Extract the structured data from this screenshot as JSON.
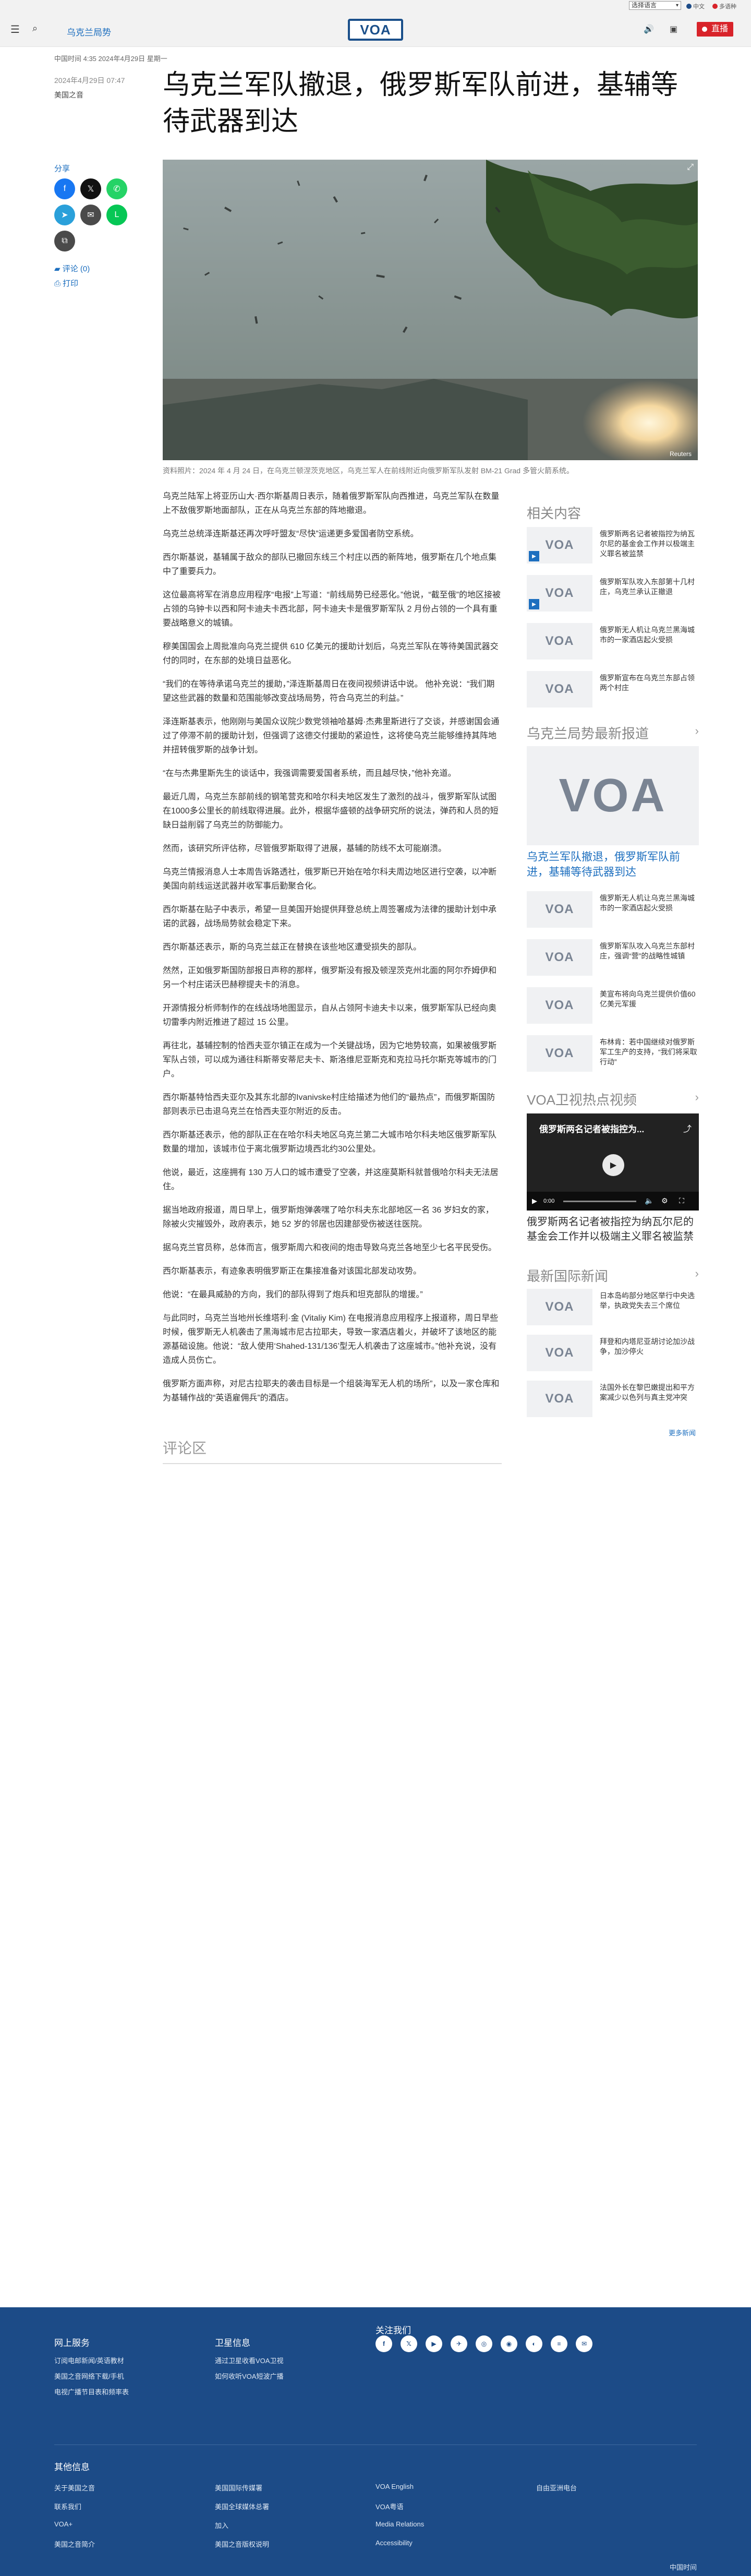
{
  "util": {
    "language": "选择语言",
    "ext1": "中文",
    "ext2": "多语种"
  },
  "header": {
    "section": "乌克兰局势",
    "logo": "VOA",
    "live": "直播"
  },
  "article": {
    "kicker": "中国时间 4:35 2024年4月29日 星期一",
    "date": "2024年4月29日 07:47",
    "source": "美国之音",
    "title": "乌克兰军队撤退，俄罗斯军队前进，基辅等待武器到达",
    "share_label": "分享",
    "comments_link": "评论 (0)",
    "print_link": "打印",
    "image_credit": "Reuters",
    "caption": "资料照片：2024 年 4 月 24 日，在乌克兰顿涅茨克地区，乌克兰军人在前线附近向俄罗斯军队发射 BM-21 Grad 多管火箭系统。",
    "paragraphs": [
      "乌克兰陆军上将亚历山大·西尔斯基周日表示，随着俄罗斯军队向西推进，乌克兰军队在数量上不敌俄罗斯地面部队，正在从乌克兰东部的阵地撤退。",
      "乌克兰总统泽连斯基还再次呼吁盟友“尽快”运递更多爱国者防空系统。",
      "西尔斯基说，基辅属于敌众的部队已撤回东线三个村庄以西的新阵地，俄罗斯在几个地点集中了重要兵力。",
      "这位最高将军在消息应用程序“电报”上写道：“前线局势已经恶化。”他说，“截至俄”的地区接被占领的乌钟卡以西和阿卡迪夫卡西北部，阿卡迪夫卡是俄罗斯军队 2 月份占领的一个具有重要战略意义的城镇。",
      "穆美国国会上周批准向乌克兰提供 610 亿美元的援助计划后，乌克兰军队在等待美国武器交付的同时，在东部的处境日益恶化。",
      "“我们的在等待承诺乌克兰的援助，”泽连斯基周日在夜间视频讲话中说。 他补充说：“我们期望这些武器的数量和范围能够改变战场局势，符合乌克兰的利益。”",
      "泽连斯基表示，他刚刚与美国众议院少数党领袖哈基姆·杰弗里斯进行了交谈，并感谢国会通过了停滞不前的援助计划，但强调了这德交付援助的紧迫性，这将使乌克兰能够维持其阵地并扭转俄罗斯的战争计划。",
      "“在与杰弗里斯先生的谈话中，我强调需要爱国者系统，而且越尽快，”他补充道。",
      "最近几周，乌克兰东部前线的钢笔营克和哈尔科夫地区发生了激烈的战斗，俄罗斯军队试图在1000多公里长的前线取得进展。此外，根据华盛顿的战争研究所的说法，弹药和人员的短缺日益削弱了乌克兰的防御能力。",
      "然而，该研究所评估称，尽管俄罗斯取得了进展，基辅的防线不太可能崩溃。",
      "乌克兰情报消息人士本周告诉路透社，俄罗斯已开始在哈尔科夫周边地区进行空袭，以冲断美国向前线运送武器并收军事后勤聚合化。",
      "西尔斯基在贴子中表示，希望一旦美国开始提供拜登总统上周签署成为法律的援助计划中承诺的武器，战场局势就会稳定下来。",
      "西尔斯基还表示，斯的乌克兰兹正在替换在该些地区遭受损失的部队。",
      "然然，正如俄罗斯国防部报日声称的那样，俄罗斯没有报及顿涅茨克州北面的阿尔乔姆伊和另一个村庄诺沃巴赫穆提夫卡的消息。",
      "开源情报分析师制作的在线战场地图显示，自从占领阿卡迪夫卡以来，俄罗斯军队已经向奥切雷季内附近推进了超过 15 公里。",
      "再往北，基辅控制的恰西夫亚尔镇正在成为一个关键战场，因为它地势较高，如果被俄罗斯军队占领，可以成为通往科斯蒂安蒂尼夫卡、斯洛维尼亚斯克和克拉马托尔斯克等城市的门户。",
      "西尔斯基特恰西夫亚尔及其东北部的Ivanivske村庄给描述为他们的“最热点”，而俄罗斯国防部则表示已击退乌克兰在恰西夫亚尔附近的反击。",
      "西尔斯基还表示，他的部队正在在哈尔科夫地区乌克兰第二大城市哈尔科夫地区俄罗斯军队数量的增加，该城市位于离北俄罗斯边境西北约30公里处。",
      "他说，最近，这座拥有 130 万人口的城市遭受了空袭，并这座莫斯科就普俄哈尔科夫无法居住。",
      "据当地政府报道，周日早上，俄罗斯炮弹袭嘿了哈尔科夫东北部地区一名 36 岁妇女的家，除被火灾摧毁外，政府表示，她 52 岁的邻居也因建部受伤被送往医院。",
      "据乌克兰官员称，总体而言，俄罗斯周六和夜间的炮击导致乌克兰各地至少七名平民受伤。",
      "西尔斯基表示，有迹象表明俄罗斯正在集接准备对该国北部发动攻势。",
      "他说：“在最具威胁的方向，我们的部队得到了炮兵和坦克部队的增援。”",
      "与此同时，乌克兰当地州长维塔利·金 (Vitaliy Kim) 在电报消息应用程序上报道称，周日早些时候，俄罗斯无人机袭击了黑海城市尼古拉耶夫，导致一家酒店着火，并破坏了该地区的能源基础设施。他说：“敌人使用‘Shahed-131/136’型无人机袭击了这座城市。”他补充说，没有造成人员伤亡。",
      "俄罗斯方面声称，对尼古拉耶夫的袭击目标是一个组装海军无人机的场所”，以及一家仓库和为基辅作战的“英语雇佣兵”的酒店。"
    ],
    "comments_title": "评论区"
  },
  "share_buttons": [
    {
      "name": "facebook-share-button",
      "icon": "f",
      "color": "#1877f2"
    },
    {
      "name": "x-share-button",
      "icon": "𝕏",
      "color": "#111111"
    },
    {
      "name": "whatsapp-share-button",
      "icon": "✆",
      "color": "#25d366"
    },
    {
      "name": "telegram-share-button",
      "icon": "➤",
      "color": "#2aa0da"
    },
    {
      "name": "email-share-button",
      "icon": "✉",
      "color": "#4a4a4a"
    },
    {
      "name": "line-share-button",
      "icon": "L",
      "color": "#06c755"
    },
    {
      "name": "copy-link-button",
      "icon": "⧉",
      "color": "#4a4a4a"
    }
  ],
  "sidebar": {
    "related_title": "相关内容",
    "related": [
      "俄罗斯两名记者被指控为纳瓦尔尼的基金会工作并以极端主义罪名被监禁",
      "俄罗斯军队攻入东部第十几村庄，乌克兰承认正撤退",
      "俄罗斯无人机让乌克兰黑海城市的一家酒店起火受损",
      "俄罗斯宣布在乌克兰东部占领两个村庄"
    ],
    "latest_title": "乌克兰局势最新报道",
    "big_title": "乌克兰军队撤退，俄罗斯军队前进，基辅等待武器到达",
    "latest": [
      "俄罗斯无人机让乌克兰黑海城市的一家酒店起火受损",
      "俄罗斯军队攻入乌克兰东部村庄，强调“营”的战略性城镇",
      "美宣布将向乌克兰提供价值60亿美元军援",
      "布林肯：若中国继续对俄罗斯军工生产的支持，“我们将采取行动”"
    ],
    "video_title": "VOA卫视热点视频",
    "video_overlay": "俄罗斯两名记者被指控为...",
    "video_time": "0:00",
    "video_caption": "俄罗斯两名记者被指控为纳瓦尔尼的基金会工作并以极端主义罪名被监禁",
    "intl_title": "最新国际新闻",
    "intl": [
      "日本岛屿部分地区举行中央选举，执政党失去三个席位",
      "拜登和内塔尼亚胡讨论加沙战争，加沙停火",
      "法国外长在黎巴嫩提出和平方案减少以色列与真主党冲突"
    ],
    "more_news": "更多新闻"
  },
  "footer": {
    "col1_title": "网上服务",
    "col1": [
      "订阅电邮新闻/英语教材",
      "美国之音网络下载/手机",
      "电视广播节目表和频率表"
    ],
    "col2_title": "卫星信息",
    "col2": [
      "通过卫星收看VOA卫视",
      "如何收听VOA短波广播"
    ],
    "col3_title": "关注我们",
    "social": [
      "f",
      "𝕏",
      "▶",
      "✈",
      "◎",
      "◉",
      "◐",
      "≡",
      "✉"
    ],
    "other_title": "其他信息",
    "links": [
      [
        "关于美国之音",
        "美国国际传媒署",
        "VOA English",
        "自由亚洲电台"
      ],
      [
        "联系我们",
        "美国全球媒体总署",
        "VOA粤语",
        ""
      ],
      [
        "VOA+",
        "加入",
        "Media Relations",
        ""
      ],
      [
        "美国之音简介",
        "美国之音版权说明",
        "Accessibility",
        ""
      ]
    ],
    "copyright": "中国时间"
  }
}
